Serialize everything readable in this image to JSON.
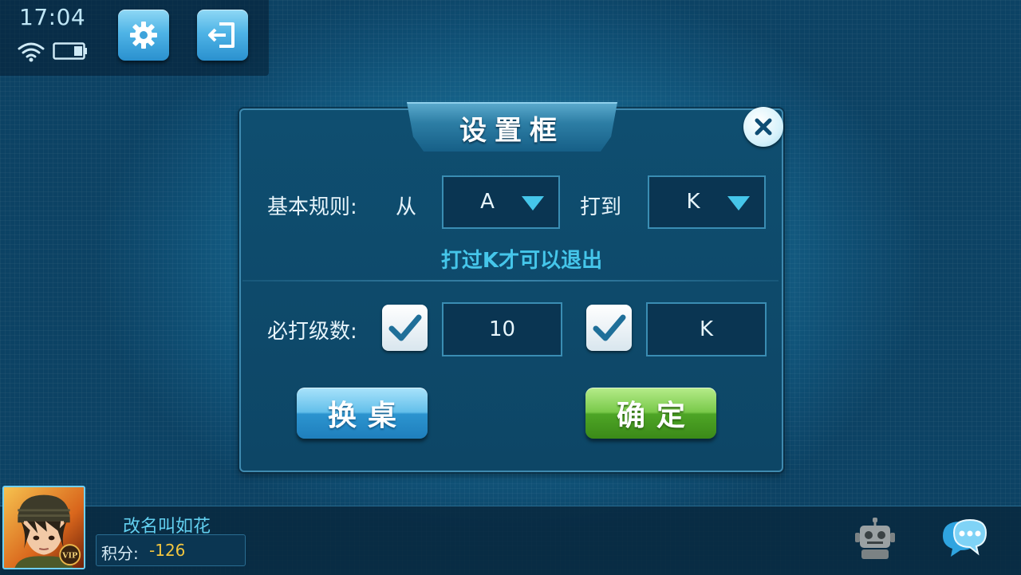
{
  "status": {
    "time": "17:04",
    "wifi_icon": "wifi-icon",
    "battery_icon": "battery-icon"
  },
  "toolbar": {
    "settings_icon": "gear-icon",
    "exit_icon": "exit-icon"
  },
  "dialog": {
    "title": "设置框",
    "close_icon": "close-icon",
    "rules": {
      "label": "基本规则:",
      "from_label": "从",
      "from_value": "A",
      "to_label": "打到",
      "to_value": "K"
    },
    "hint": "打过K才可以退出",
    "required_level": {
      "label": "必打级数:",
      "checkbox1_checked": true,
      "value1": "10",
      "checkbox2_checked": true,
      "value2": "K"
    },
    "buttons": {
      "change_table": "换桌",
      "confirm": "确定"
    }
  },
  "player": {
    "name": "改名叫如花",
    "score_label": "积分:",
    "score_value": "-126",
    "badge": "VIP"
  },
  "bottom_icons": {
    "robot_icon": "robot-icon",
    "chat_icon": "chat-icon"
  },
  "colors": {
    "accent": "#45c6ea",
    "confirm_green": "#4ea526",
    "change_blue": "#2c94cf",
    "score": "#f3c63f"
  }
}
